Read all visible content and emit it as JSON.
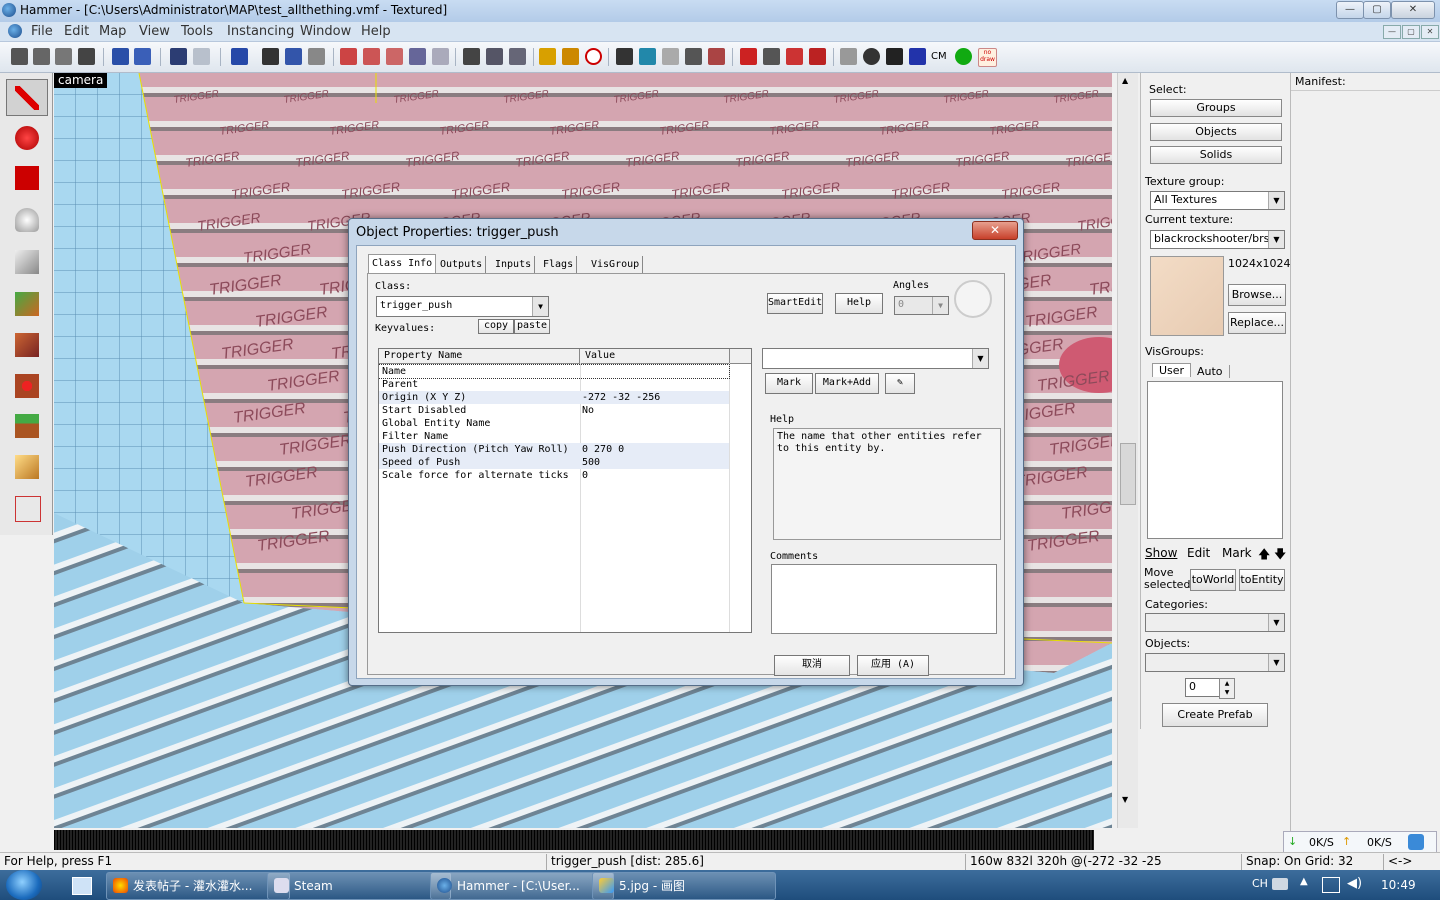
{
  "window": {
    "title": "Hammer - [C:\\Users\\Administrator\\MAP\\test_allthething.vmf - Textured]",
    "min": "—",
    "max": "▢",
    "close": "✕"
  },
  "menu": [
    "File",
    "Edit",
    "Map",
    "View",
    "Tools",
    "Instancing",
    "Window",
    "Help"
  ],
  "toolbar": {
    "cm_label": "CM",
    "nodraw_label": "no draw"
  },
  "viewport": {
    "camera_label": "camera",
    "texture_word": "TRIGGER"
  },
  "right_panel": {
    "select_label": "Select:",
    "select_buttons": [
      "Groups",
      "Objects",
      "Solids"
    ],
    "texture_group_label": "Texture group:",
    "texture_group_value": "All Textures",
    "current_texture_label": "Current texture:",
    "current_texture_value": "blackrockshooter/brsbc",
    "texture_size": "1024x1024",
    "browse": "Browse...",
    "replace": "Replace...",
    "visgroups_label": "VisGroups:",
    "visgroup_tabs": [
      "User",
      "Auto"
    ],
    "show": "Show",
    "edit": "Edit",
    "mark": "Mark",
    "up": "🡅",
    "down": "🡇",
    "move_selected": "Move\nselected:",
    "to_world": "toWorld",
    "to_entity": "toEntity",
    "categories_label": "Categories:",
    "objects_label": "Objects:",
    "spin_value": "0",
    "create_prefab": "Create Prefab"
  },
  "manifest": {
    "label": "Manifest:"
  },
  "net": {
    "down": "0K/S",
    "up": "0K/S"
  },
  "dialog": {
    "title": "Object Properties: trigger_push",
    "close": "✕",
    "tabs": [
      "Class Info",
      "Outputs",
      "Inputs",
      "Flags",
      "VisGroup"
    ],
    "class_label": "Class:",
    "class_value": "trigger_push",
    "keyvalues_label": "Keyvalues:",
    "copy": "copy",
    "paste": "paste",
    "smartedit": "SmartEdit",
    "help_button": "Help",
    "angles_label": "Angles",
    "angles_value": "0",
    "columns": [
      "Property Name",
      "Value"
    ],
    "rows": [
      {
        "name": "Name",
        "value": ""
      },
      {
        "name": "Parent",
        "value": ""
      },
      {
        "name": "Origin (X Y Z)",
        "value": "-272 -32 -256"
      },
      {
        "name": "Start Disabled",
        "value": "No"
      },
      {
        "name": "Global Entity Name",
        "value": ""
      },
      {
        "name": "Filter Name",
        "value": ""
      },
      {
        "name": "Push Direction (Pitch Yaw Roll)",
        "value": "0 270 0"
      },
      {
        "name": "Speed of Push",
        "value": "500"
      },
      {
        "name": "Scale force for alternate ticks",
        "value": "0"
      }
    ],
    "mark": "Mark",
    "mark_add": "Mark+Add",
    "help_label": "Help",
    "help_text": "The name that other entities refer to this entity by.",
    "comments_label": "Comments",
    "cancel": "取消",
    "apply": "应用 (A)"
  },
  "status": {
    "help": "For Help, press F1",
    "selection": "trigger_push   [dist: 285.6]",
    "size": "160w 832l 320h @(-272 -32 -25",
    "snap": "Snap: On Grid: 32",
    "arrows": "<->"
  },
  "taskbar": {
    "tasks": [
      "发表帖子 - 灌水灌水...",
      "Steam",
      "Hammer - [C:\\User...",
      "5.jpg - 画图"
    ],
    "lang": "CH",
    "time": "10:49"
  },
  "colors": {
    "title_bg": "#c9dcf2",
    "taskbar": "#1f4d7c",
    "trigger_pink": "#d8aab4",
    "floor_blue": "#9cd0ec"
  }
}
